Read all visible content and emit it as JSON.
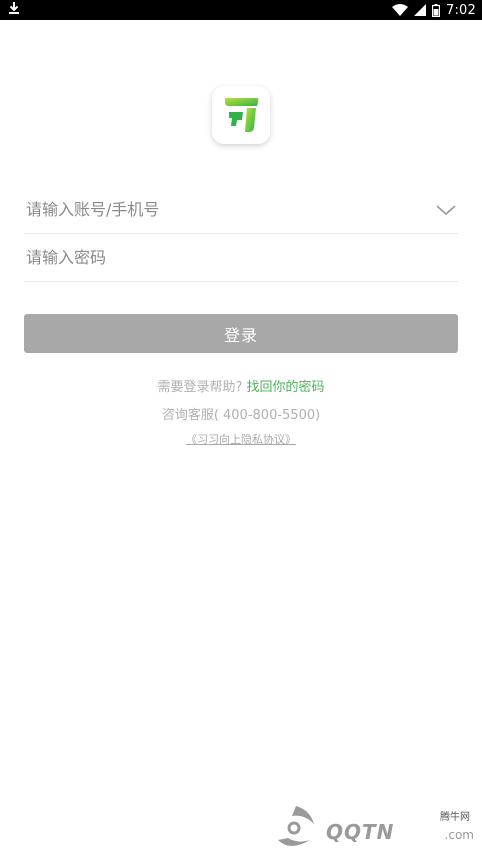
{
  "status_bar": {
    "time": "7:02",
    "icons": [
      "download-icon",
      "wifi-icon",
      "signal-icon",
      "battery-icon"
    ]
  },
  "app": {
    "logo_icon": "app-logo-icon",
    "brand_colors": {
      "green_light": "#9fd83a",
      "green_dark": "#2fb24a"
    }
  },
  "form": {
    "account_placeholder": "请输入账号/手机号",
    "password_placeholder": "请输入密码",
    "login_label": "登录"
  },
  "help": {
    "prompt": "需要登录帮助?",
    "link_text": "找回你的密码"
  },
  "service": {
    "text": "咨询客服( 400-800-5500)"
  },
  "privacy": {
    "text": "《习习向上隐私协议》"
  },
  "watermark": {
    "main": "QQTN",
    "small": "腾牛网",
    "suffix": ".com"
  }
}
